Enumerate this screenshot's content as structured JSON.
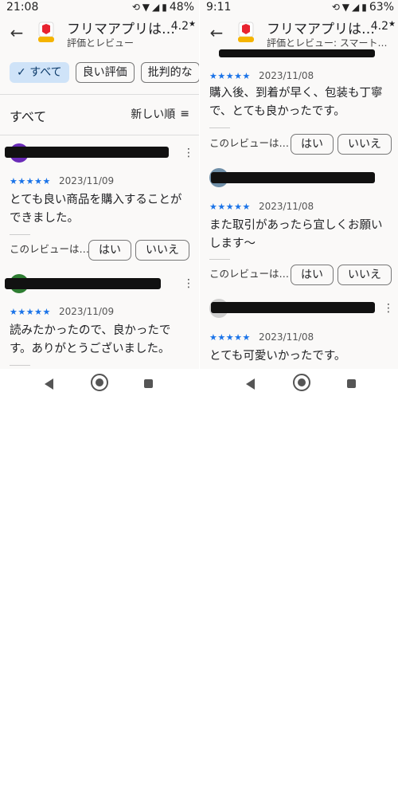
{
  "left": {
    "status": {
      "time": "21:08",
      "battery": "48%"
    },
    "header": {
      "title": "フリマアプリは…",
      "subtitle": "評価とレビュー",
      "rating": "4.2",
      "star": "★"
    },
    "chips": [
      "すべて",
      "良い評価",
      "批判的な"
    ],
    "chip_check": "✓",
    "sort": {
      "label": "すべて",
      "order": "新しい順"
    },
    "reviews": [
      {
        "stars": "★★★★★",
        "date": "2023/11/09",
        "text": "とても良い商品を購入することができました。",
        "helpful": "このレビューは…",
        "yes": "はい",
        "no": "いいえ",
        "avatar_color": "#6a2bb8"
      },
      {
        "stars": "★★★★★",
        "date": "2023/11/09",
        "text": "読みたかったので、良かったです。ありがとうございました。",
        "avatar_color": "#2e7d32"
      }
    ]
  },
  "right": {
    "status": {
      "time": "9:11",
      "battery": "63%"
    },
    "header": {
      "title": "フリマアプリは…",
      "subtitle": "評価とレビュー: スマート…",
      "rating": "4.2",
      "star": "★"
    },
    "reviews": [
      {
        "stars": "★★★★★",
        "date": "2023/11/08",
        "text": "購入後、到着が早く、包装も丁寧で、とても良かったです。",
        "helpful": "このレビューは…",
        "yes": "はい",
        "no": "いいえ"
      },
      {
        "stars": "★★★★★",
        "date": "2023/11/08",
        "text": "また取引があったら宜しくお願いします〜",
        "helpful": "このレビューは…",
        "yes": "はい",
        "no": "いいえ",
        "avatar_color": "#6f8fa8"
      },
      {
        "stars": "★★★★★",
        "date": "2023/11/08",
        "text": "とても可愛いかったです。",
        "avatar_color": "#cfcfcf"
      }
    ]
  },
  "more_glyph": "⋮",
  "sort_icon": "≡"
}
